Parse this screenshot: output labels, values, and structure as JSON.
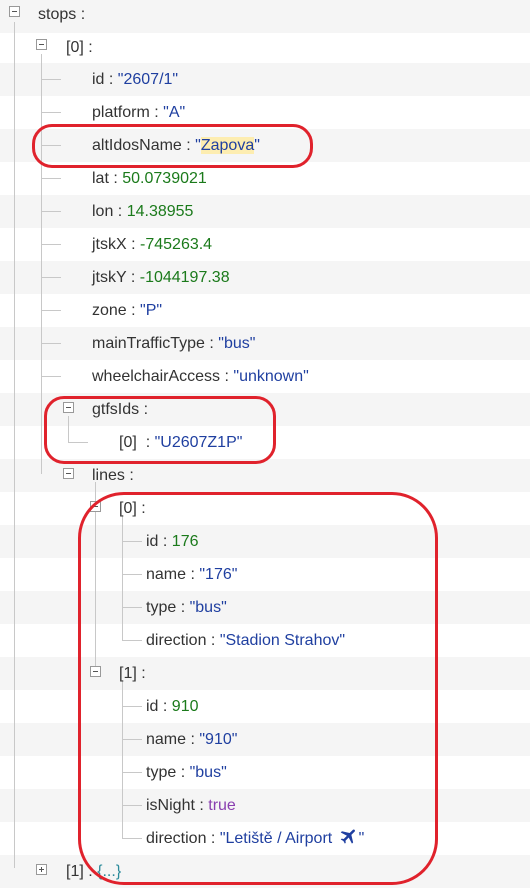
{
  "tree": {
    "root": {
      "key": "stops",
      "sep": " :"
    },
    "item0": {
      "index": "[0]",
      "sep": " :",
      "id": {
        "key": "id",
        "value": "\"2607/1\""
      },
      "platform": {
        "key": "platform",
        "value": "\"A\""
      },
      "altIdosName": {
        "key": "altIdosName",
        "value_pre": "\"",
        "value_hl": "Zapova",
        "value_post": "\""
      },
      "lat": {
        "key": "lat",
        "value": "50.0739021"
      },
      "lon": {
        "key": "lon",
        "value": "14.38955"
      },
      "jtskX": {
        "key": "jtskX",
        "value": "-745263.4"
      },
      "jtskY": {
        "key": "jtskY",
        "value": "-1044197.38"
      },
      "zone": {
        "key": "zone",
        "value": "\"P\""
      },
      "mainTrafficType": {
        "key": "mainTrafficType",
        "value": "\"bus\""
      },
      "wheelchairAccess": {
        "key": "wheelchairAccess",
        "value": "\"unknown\""
      },
      "gtfsIds": {
        "key": "gtfsIds",
        "sep": " :",
        "item0_index": "[0]",
        "item0_value": "\"U2607Z1P\""
      },
      "lines": {
        "key": "lines",
        "sep": " :",
        "l0": {
          "index": "[0]",
          "sep": " :",
          "id": {
            "key": "id",
            "value": "176"
          },
          "name": {
            "key": "name",
            "value": "\"176\""
          },
          "type": {
            "key": "type",
            "value": "\"bus\""
          },
          "direction": {
            "key": "direction",
            "value": "\"Stadion Strahov\""
          }
        },
        "l1": {
          "index": "[1]",
          "sep": " :",
          "id": {
            "key": "id",
            "value": "910"
          },
          "name": {
            "key": "name",
            "value": "\"910\""
          },
          "type": {
            "key": "type",
            "value": "\"bus\""
          },
          "isNight": {
            "key": "isNight",
            "value": "true"
          },
          "direction": {
            "key": "direction",
            "value_pre": "\"Letiště / Airport ",
            "value_post": "\""
          }
        }
      }
    },
    "item1": {
      "index": "[1]",
      "sep": " : ",
      "collapsed": "{...}"
    }
  },
  "colors": {
    "string": "#1f3fa0",
    "number": "#1b7a1b",
    "boolean": "#8a3fb0",
    "annotation": "#e0222c",
    "highlight": "#fdedb0"
  },
  "icons": {
    "airplane": "airplane-icon",
    "expand": "plus-icon",
    "collapse": "minus-icon"
  }
}
